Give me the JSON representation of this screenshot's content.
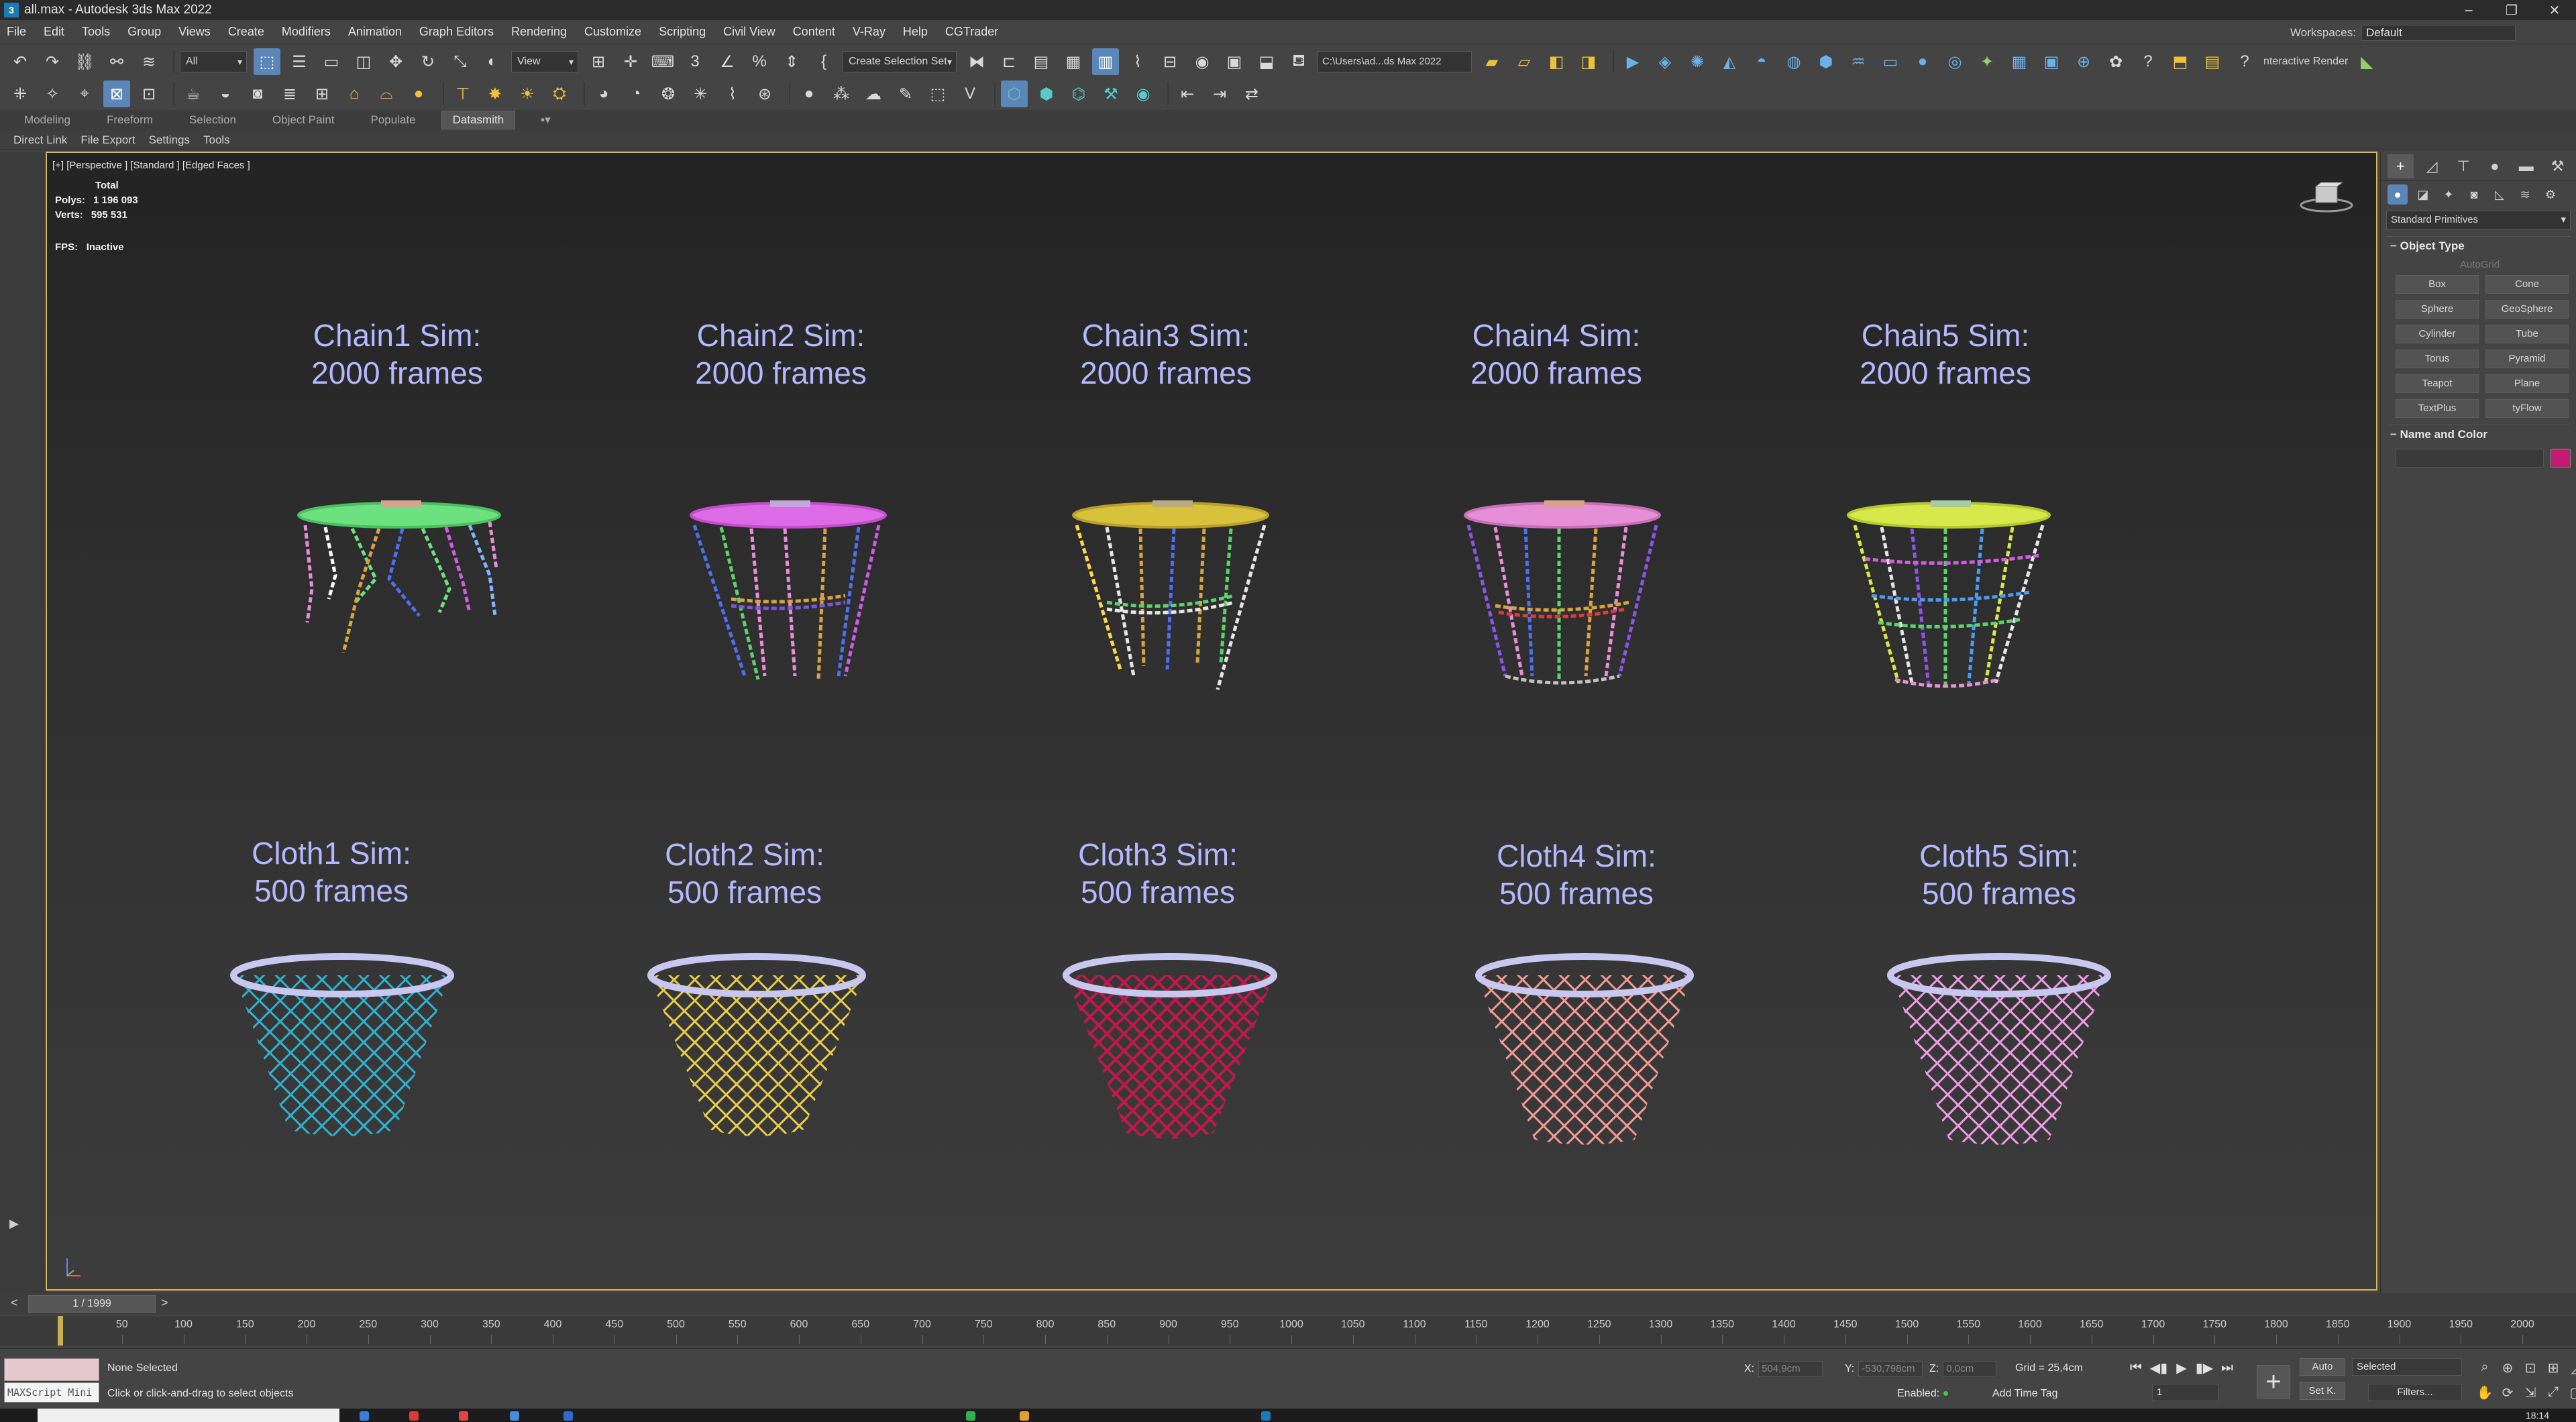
{
  "window": {
    "title": "all.max - Autodesk 3ds Max 2022",
    "app_icon": "3"
  },
  "menu": [
    "File",
    "Edit",
    "Tools",
    "Group",
    "Views",
    "Create",
    "Modifiers",
    "Animation",
    "Graph Editors",
    "Rendering",
    "Customize",
    "Scripting",
    "Civil View",
    "Content",
    "V-Ray",
    "Help",
    "CGTrader"
  ],
  "workspace": {
    "label": "Workspaces:",
    "value": "Default"
  },
  "toolbar": {
    "filter_value": "All",
    "refcoord_value": "View",
    "selection_set_placeholder": "Create Selection Set",
    "project_path": "C:\\Users\\ad...ds Max 2022",
    "interactive_label": "nteractive Render"
  },
  "ribbon": {
    "tabs": [
      "Modeling",
      "Freeform",
      "Selection",
      "Object Paint",
      "Populate",
      "Datasmith"
    ],
    "active": "Datasmith"
  },
  "subtabs": [
    "Direct Link",
    "File Export",
    "Settings",
    "Tools"
  ],
  "viewport": {
    "label": "[+] [Perspective ] [Standard ] [Edged Faces ]",
    "stats_total": "Total",
    "polys_label": "Polys:",
    "polys_value": "1 196 093",
    "verts_label": "Verts:",
    "verts_value": "595 531",
    "fps_label": "FPS:",
    "fps_value": "Inactive"
  },
  "chains": [
    {
      "line1": "Chain1 Sim:",
      "line2": "2000 frames",
      "rim": "#6de07f"
    },
    {
      "line1": "Chain2 Sim:",
      "line2": "2000 frames",
      "rim": "#de6be6"
    },
    {
      "line1": "Chain3 Sim:",
      "line2": "2000 frames",
      "rim": "#d8c13b"
    },
    {
      "line1": "Chain4 Sim:",
      "line2": "2000 frames",
      "rim": "#e48fd6"
    },
    {
      "line1": "Chain5 Sim:",
      "line2": "2000 frames",
      "rim": "#d6e84a"
    }
  ],
  "cloths": [
    {
      "line1": "Cloth1 Sim:",
      "line2": "500 frames",
      "net": "#2fb2cf"
    },
    {
      "line1": "Cloth2 Sim:",
      "line2": "500 frames",
      "net": "#e6cc4a"
    },
    {
      "line1": "Cloth3 Sim:",
      "line2": "500 frames",
      "net": "#c0184e"
    },
    {
      "line1": "Cloth4 Sim:",
      "line2": "500 frames",
      "net": "#f29a93"
    },
    {
      "line1": "Cloth5 Sim:",
      "line2": "500 frames",
      "net": "#ee9be4"
    }
  ],
  "command_panel": {
    "category": "Standard Primitives",
    "object_type_title": "Object Type",
    "autogrid": "AutoGrid",
    "primitives": [
      "Box",
      "Cone",
      "Sphere",
      "GeoSphere",
      "Cylinder",
      "Tube",
      "Torus",
      "Pyramid",
      "Teapot",
      "Plane",
      "TextPlus",
      "tyFlow"
    ],
    "name_color_title": "Name and Color",
    "object_color": "#c31b6f"
  },
  "timeline": {
    "frame_display": "1 / 1999",
    "ticks": [
      "50",
      "100",
      "150",
      "200",
      "250",
      "300",
      "350",
      "400",
      "450",
      "500",
      "550",
      "600",
      "650",
      "700",
      "750",
      "800",
      "850",
      "900",
      "950",
      "1000",
      "1050",
      "1100",
      "1150",
      "1200",
      "1250",
      "1300",
      "1350",
      "1400",
      "1450",
      "1500",
      "1550",
      "1600",
      "1650",
      "1700",
      "1750",
      "1800",
      "1850",
      "1900",
      "1950",
      "2000"
    ]
  },
  "status": {
    "maxscript_label": "MAXScript Mini",
    "selection": "None Selected",
    "prompt": "Click or click-and-drag to select objects",
    "x_label": "X:",
    "x_value": "504,9cm",
    "y_label": "Y:",
    "y_value": "-530,798cm",
    "z_label": "Z:",
    "z_value": "0,0cm",
    "grid": "Grid = 25,4cm",
    "enabled_label": "Enabled:",
    "add_time_tag": "Add Time Tag",
    "frame_value": "1",
    "auto_label": "Auto",
    "setk_label": "Set K.",
    "selected_value": "Selected",
    "filters_label": "Filters..."
  },
  "taskbar": {
    "clock": "18:14"
  }
}
